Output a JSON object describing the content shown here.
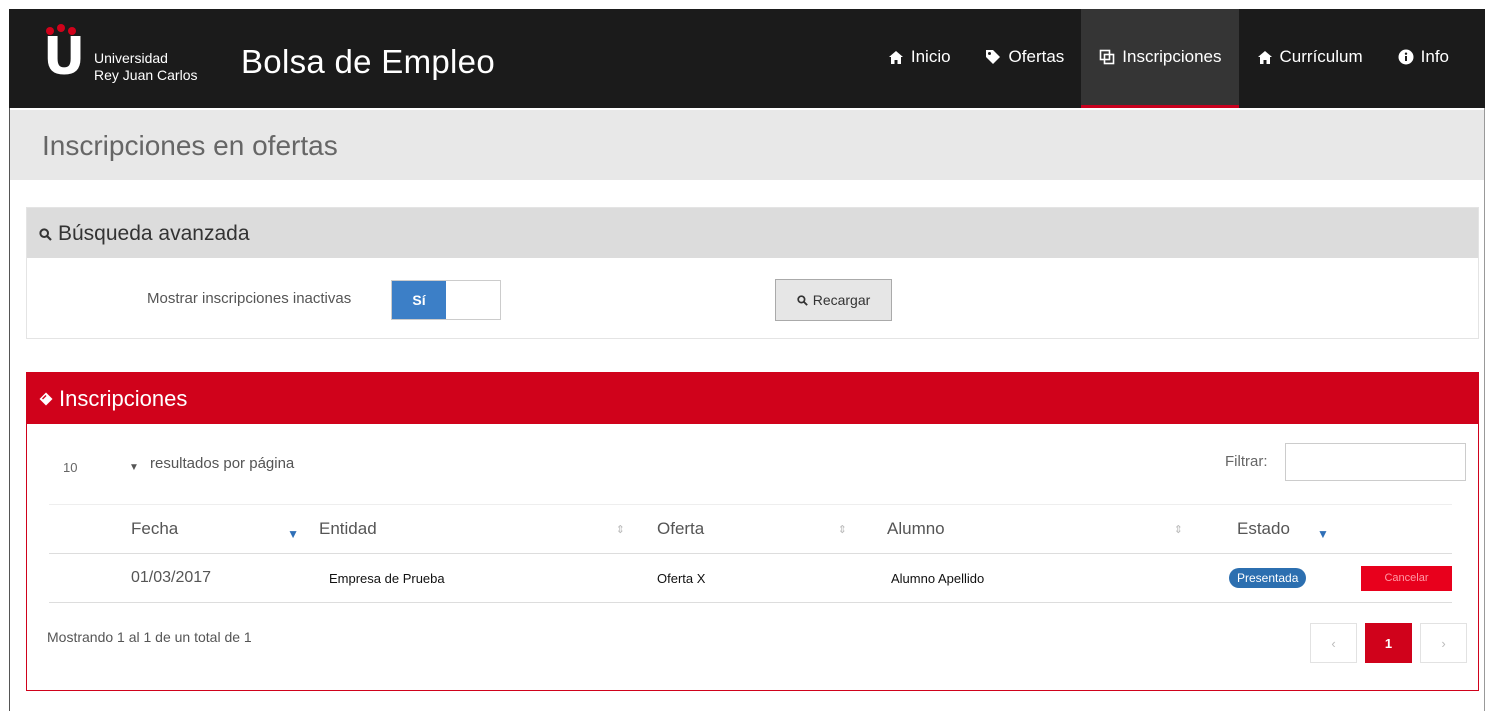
{
  "navbar": {
    "university_line1": "Universidad",
    "university_line2": "Rey Juan Carlos",
    "brand": "Bolsa de Empleo",
    "items": [
      {
        "label": "Inicio",
        "icon": "home-icon"
      },
      {
        "label": "Ofertas",
        "icon": "tag-icon"
      },
      {
        "label": "Inscripciones",
        "icon": "copy-icon"
      },
      {
        "label": "Currículum",
        "icon": "home-icon"
      },
      {
        "label": "Info",
        "icon": "info-circle-icon"
      }
    ],
    "active_index": 2,
    "accent": "#c8001e"
  },
  "page": {
    "title": "Inscripciones en ofertas"
  },
  "search": {
    "title": "Búsqueda avanzada",
    "inactive_label": "Mostrar inscripciones inactivas",
    "toggle_on": "Sí",
    "reload_label": "Recargar"
  },
  "inscripciones": {
    "title": "Inscripciones",
    "page_size": "10",
    "per_page_label": "resultados por página",
    "filter_label": "Filtrar:",
    "columns": [
      "Fecha",
      "Entidad",
      "Oferta",
      "Alumno",
      "Estado"
    ],
    "rows": [
      {
        "fecha": "01/03/2017",
        "entidad": "Empresa de Prueba",
        "oferta": "Oferta X",
        "alumno": "Alumno Apellido",
        "estado": "Presentada",
        "action": "Cancelar"
      }
    ],
    "showing": "Mostrando 1 al 1 de un total de 1",
    "pager": {
      "prev": "‹",
      "current": "1",
      "next": "›"
    },
    "color": "#d0021b"
  }
}
